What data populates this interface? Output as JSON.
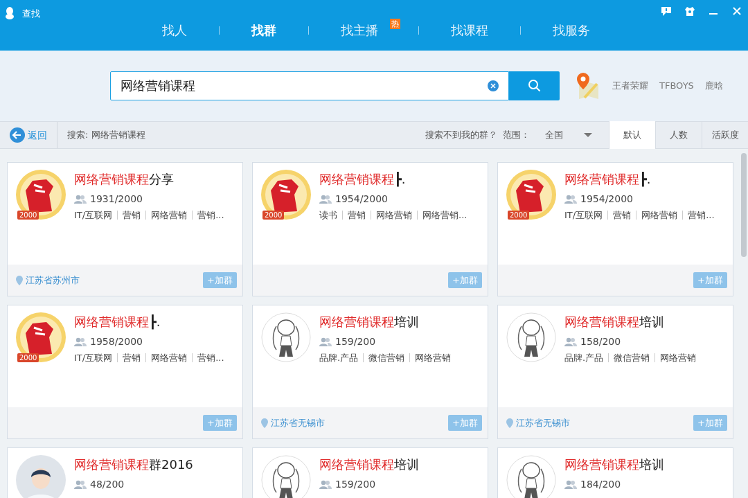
{
  "window": {
    "title": "查找"
  },
  "tabs": [
    {
      "label": "找人",
      "selected": false
    },
    {
      "label": "找群",
      "selected": true
    },
    {
      "label": "找主播",
      "selected": false,
      "badge": "热"
    },
    {
      "label": "找课程",
      "selected": false
    },
    {
      "label": "找服务",
      "selected": false
    }
  ],
  "search": {
    "value": "网络营销课程"
  },
  "hot_keywords": [
    "王者荣耀",
    "TFBOYS",
    "鹿晗"
  ],
  "toolbar": {
    "back": "返回",
    "query": "搜索: 网络营销课程",
    "help": "搜索不到我的群？",
    "range_label": "范围：",
    "range_value": "全国",
    "sorts": [
      {
        "label": "默认",
        "selected": true
      },
      {
        "label": "人数",
        "selected": false
      },
      {
        "label": "活跃度",
        "selected": false
      }
    ]
  },
  "groups": [
    {
      "kind": "fist",
      "avatar_badge": "2000",
      "title_match": "网络营销课程",
      "title_rest": "分享",
      "members": "1931/2000",
      "tags": [
        "IT/互联网",
        "营销",
        "网络营销",
        "营销..."
      ],
      "location": "江苏省苏州市",
      "join": "+加群"
    },
    {
      "kind": "fist",
      "avatar_badge": "2000",
      "title_match": "网络营销课程",
      "title_rest": "┣.",
      "members": "1954/2000",
      "tags": [
        "读书",
        "营销",
        "网络营销",
        "网络营销..."
      ],
      "join": "+加群"
    },
    {
      "kind": "fist",
      "avatar_badge": "2000",
      "title_match": "网络营销课程",
      "title_rest": "┣.",
      "members": "1954/2000",
      "tags": [
        "IT/互联网",
        "营销",
        "网络营销",
        "营销..."
      ],
      "join": "+加群"
    },
    {
      "kind": "fist",
      "avatar_badge": "2000",
      "title_match": "网络营销课程",
      "title_rest": "┣.",
      "members": "1958/2000",
      "tags": [
        "IT/互联网",
        "营销",
        "网络营销",
        "营销..."
      ],
      "join": "+加群"
    },
    {
      "kind": "anime",
      "title_match": "网络营销课程",
      "title_rest": "培训",
      "members": "159/200",
      "tags": [
        "品牌.产品",
        "微信营销",
        "网络营销"
      ],
      "location": "江苏省无锡市",
      "join": "+加群"
    },
    {
      "kind": "anime",
      "title_match": "网络营销课程",
      "title_rest": "培训",
      "members": "158/200",
      "tags": [
        "品牌.产品",
        "微信营销",
        "网络营销"
      ],
      "location": "江苏省无锡市",
      "join": "+加群"
    },
    {
      "kind": "person",
      "title_match": "网络营销课程",
      "title_rest": "群2016",
      "members": "48/200"
    },
    {
      "kind": "anime",
      "title_match": "网络营销课程",
      "title_rest": "培训",
      "members": "159/200"
    },
    {
      "kind": "anime",
      "title_match": "网络营销课程",
      "title_rest": "培训",
      "members": "184/200"
    }
  ]
}
